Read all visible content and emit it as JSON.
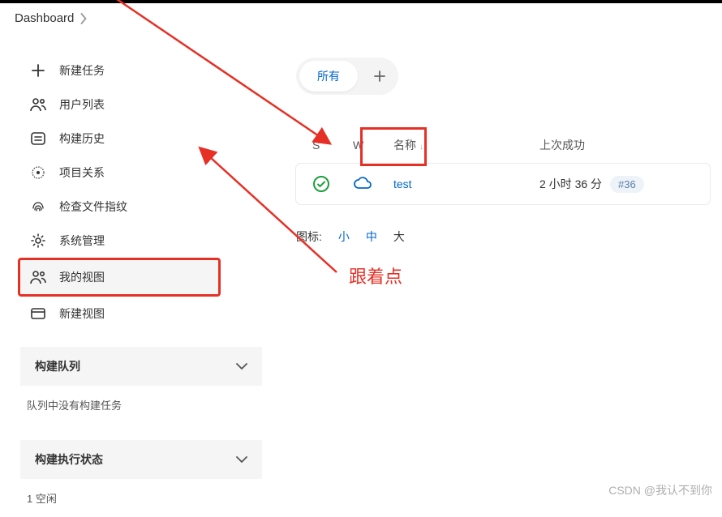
{
  "breadcrumb": {
    "root": "Dashboard"
  },
  "sidebar": {
    "items": [
      {
        "label": "新建任务"
      },
      {
        "label": "用户列表"
      },
      {
        "label": "构建历史"
      },
      {
        "label": "项目关系"
      },
      {
        "label": "检查文件指纹"
      },
      {
        "label": "系统管理"
      },
      {
        "label": "我的视图"
      },
      {
        "label": "新建视图"
      }
    ],
    "section1": {
      "title": "构建队列",
      "empty_text": "队列中没有构建任务"
    },
    "section2": {
      "title": "构建执行状态",
      "idle_text": "1  空闲"
    }
  },
  "tabs": {
    "all": "所有"
  },
  "table": {
    "headers": {
      "s": "S",
      "w": "W",
      "name": "名称",
      "last_success": "上次成功"
    },
    "rows": [
      {
        "name": "test",
        "last_success": "2 小时 36 分",
        "build": "#36"
      }
    ]
  },
  "icon_size": {
    "label": "图标:",
    "small": "小",
    "medium": "中",
    "large": "大"
  },
  "annotation": {
    "text": "跟着点"
  },
  "watermark": "CSDN @我认不到你"
}
